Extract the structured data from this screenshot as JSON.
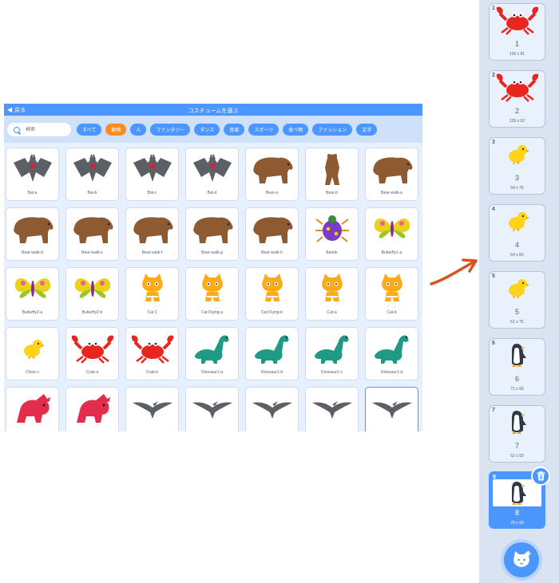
{
  "library": {
    "back_label": "戻る",
    "title": "コスチュームを選ぶ",
    "search_placeholder": "検索",
    "tags": [
      {
        "label": "すべて",
        "active": false
      },
      {
        "label": "動物",
        "active": true
      },
      {
        "label": "人",
        "active": false
      },
      {
        "label": "ファンタジー",
        "active": false
      },
      {
        "label": "ダンス",
        "active": false
      },
      {
        "label": "音楽",
        "active": false
      },
      {
        "label": "スポーツ",
        "active": false
      },
      {
        "label": "食べ物",
        "active": false
      },
      {
        "label": "ファッション",
        "active": false
      },
      {
        "label": "文字",
        "active": false
      }
    ],
    "items": [
      {
        "label": "Bat-a",
        "icon": "bat-icon"
      },
      {
        "label": "Bat-b",
        "icon": "bat-icon"
      },
      {
        "label": "Bat-c",
        "icon": "bat-icon"
      },
      {
        "label": "Bat-d",
        "icon": "bat-icon"
      },
      {
        "label": "Bear-a",
        "icon": "bear-icon"
      },
      {
        "label": "Bear-b",
        "icon": "bear-standing-icon"
      },
      {
        "label": "Bear-walk-a",
        "icon": "bear-icon"
      },
      {
        "label": "Bear-walk-d",
        "icon": "bear-icon"
      },
      {
        "label": "Bear-walk-e",
        "icon": "bear-icon"
      },
      {
        "label": "Bear-walk-f",
        "icon": "bear-icon"
      },
      {
        "label": "Bear-walk-g",
        "icon": "bear-icon"
      },
      {
        "label": "Bear-walk-h",
        "icon": "bear-icon"
      },
      {
        "label": "Beetle",
        "icon": "beetle-icon"
      },
      {
        "label": "Butterfly1-a",
        "icon": "butterfly-icon"
      },
      {
        "label": "Butterfly2-a",
        "icon": "butterfly-icon"
      },
      {
        "label": "Butterfly2-b",
        "icon": "butterfly-icon"
      },
      {
        "label": "Cat 2",
        "icon": "cat-icon"
      },
      {
        "label": "Cat Flying-a",
        "icon": "cat-icon"
      },
      {
        "label": "Cat Flying-b",
        "icon": "cat-icon"
      },
      {
        "label": "Cat-a",
        "icon": "cat-icon"
      },
      {
        "label": "Cat-b",
        "icon": "cat-icon"
      },
      {
        "label": "Chick-c",
        "icon": "chick-icon"
      },
      {
        "label": "Crab-a",
        "icon": "crab-icon"
      },
      {
        "label": "Crab-b",
        "icon": "crab-icon"
      },
      {
        "label": "Dinosaur1-a",
        "icon": "dinosaur-icon"
      },
      {
        "label": "Dinosaur1-b",
        "icon": "dinosaur-icon"
      },
      {
        "label": "Dinosaur1-c",
        "icon": "dinosaur-icon"
      },
      {
        "label": "Dinosaur1-d",
        "icon": "dinosaur-icon"
      },
      {
        "label": "",
        "icon": "triceratops-icon"
      },
      {
        "label": "",
        "icon": "triceratops-icon"
      },
      {
        "label": "",
        "icon": "pterodactyl-icon"
      },
      {
        "label": "",
        "icon": "pterodactyl-icon"
      },
      {
        "label": "",
        "icon": "pterodactyl-icon"
      },
      {
        "label": "",
        "icon": "pterodactyl-icon"
      },
      {
        "label": "",
        "icon": "pterodactyl-icon",
        "selected": true
      }
    ]
  },
  "costumes": [
    {
      "number": "1",
      "name": "1",
      "size": "135 x 91",
      "icon": "crab-icon"
    },
    {
      "number": "2",
      "name": "2",
      "size": "135 x 92",
      "icon": "crab-icon"
    },
    {
      "number": "3",
      "name": "3",
      "size": "64 x 75",
      "icon": "chick-icon"
    },
    {
      "number": "4",
      "name": "4",
      "size": "64 x 82",
      "icon": "chick-icon"
    },
    {
      "number": "5",
      "name": "5",
      "size": "61 x 75",
      "icon": "chick-icon"
    },
    {
      "number": "6",
      "name": "6",
      "size": "71 x 93",
      "icon": "penguin-icon"
    },
    {
      "number": "7",
      "name": "7",
      "size": "52 x 93",
      "icon": "penguin-icon"
    },
    {
      "number": "8",
      "name": "8",
      "size": "70 x 93",
      "icon": "penguin-icon",
      "selected": true
    }
  ],
  "colors": {
    "accent": "#4c97ff",
    "active_tag": "#ff8c1a",
    "arrow": "#d9531e",
    "panel_bg": "#d9e3f2"
  },
  "buttons": {
    "delete_icon": "trash-icon",
    "choose_costume_icon": "cat-plus-icon"
  }
}
